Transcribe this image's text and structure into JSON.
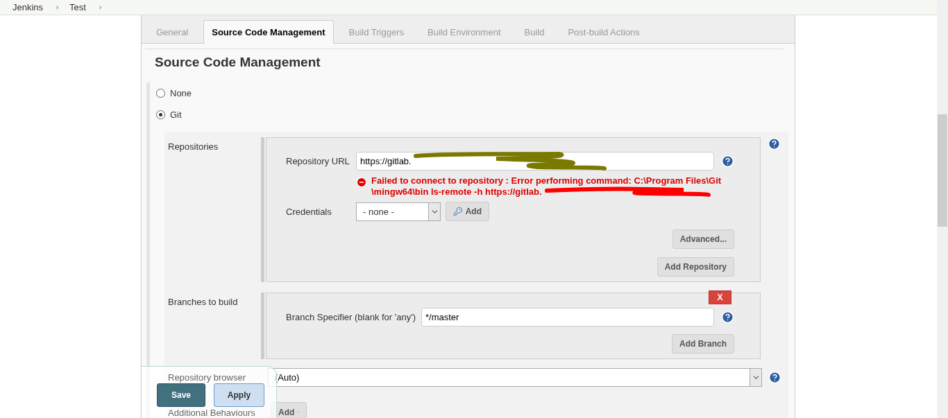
{
  "breadcrumbs": [
    "Jenkins",
    "Test"
  ],
  "tabs": [
    {
      "label": "General",
      "selected": false
    },
    {
      "label": "Source Code Management",
      "selected": true
    },
    {
      "label": "Build Triggers",
      "selected": false
    },
    {
      "label": "Build Environment",
      "selected": false
    },
    {
      "label": "Build",
      "selected": false
    },
    {
      "label": "Post-build Actions",
      "selected": false
    }
  ],
  "section_title": "Source Code Management",
  "scm_options": [
    {
      "label": "None",
      "selected": false
    },
    {
      "label": "Git",
      "selected": true
    }
  ],
  "repositories": {
    "label": "Repositories",
    "url_label": "Repository URL",
    "url_value": "https://gitlab.",
    "error_lines": [
      "Failed to connect to repository : Error performing command: C:\\Program Files\\Git",
      "\\mingw64\\bin ls-remote -h https://gitlab."
    ],
    "credentials_label": "Credentials",
    "credentials_value": "- none -",
    "add_credentials": "Add",
    "advanced": "Advanced...",
    "add_repository": "Add Repository"
  },
  "branches": {
    "label": "Branches to build",
    "delete": "X",
    "specifier_label": "Branch Specifier (blank for 'any')",
    "specifier_value": "*/master",
    "add_branch": "Add Branch"
  },
  "repository_browser": {
    "label": "Repository browser",
    "value": "(Auto)"
  },
  "additional_behaviours": {
    "label": "Additional Behaviours",
    "add": "Add"
  },
  "actions": [
    {
      "label": "Save",
      "kind": "primary"
    },
    {
      "label": "Apply",
      "kind": "secondary"
    }
  ]
}
